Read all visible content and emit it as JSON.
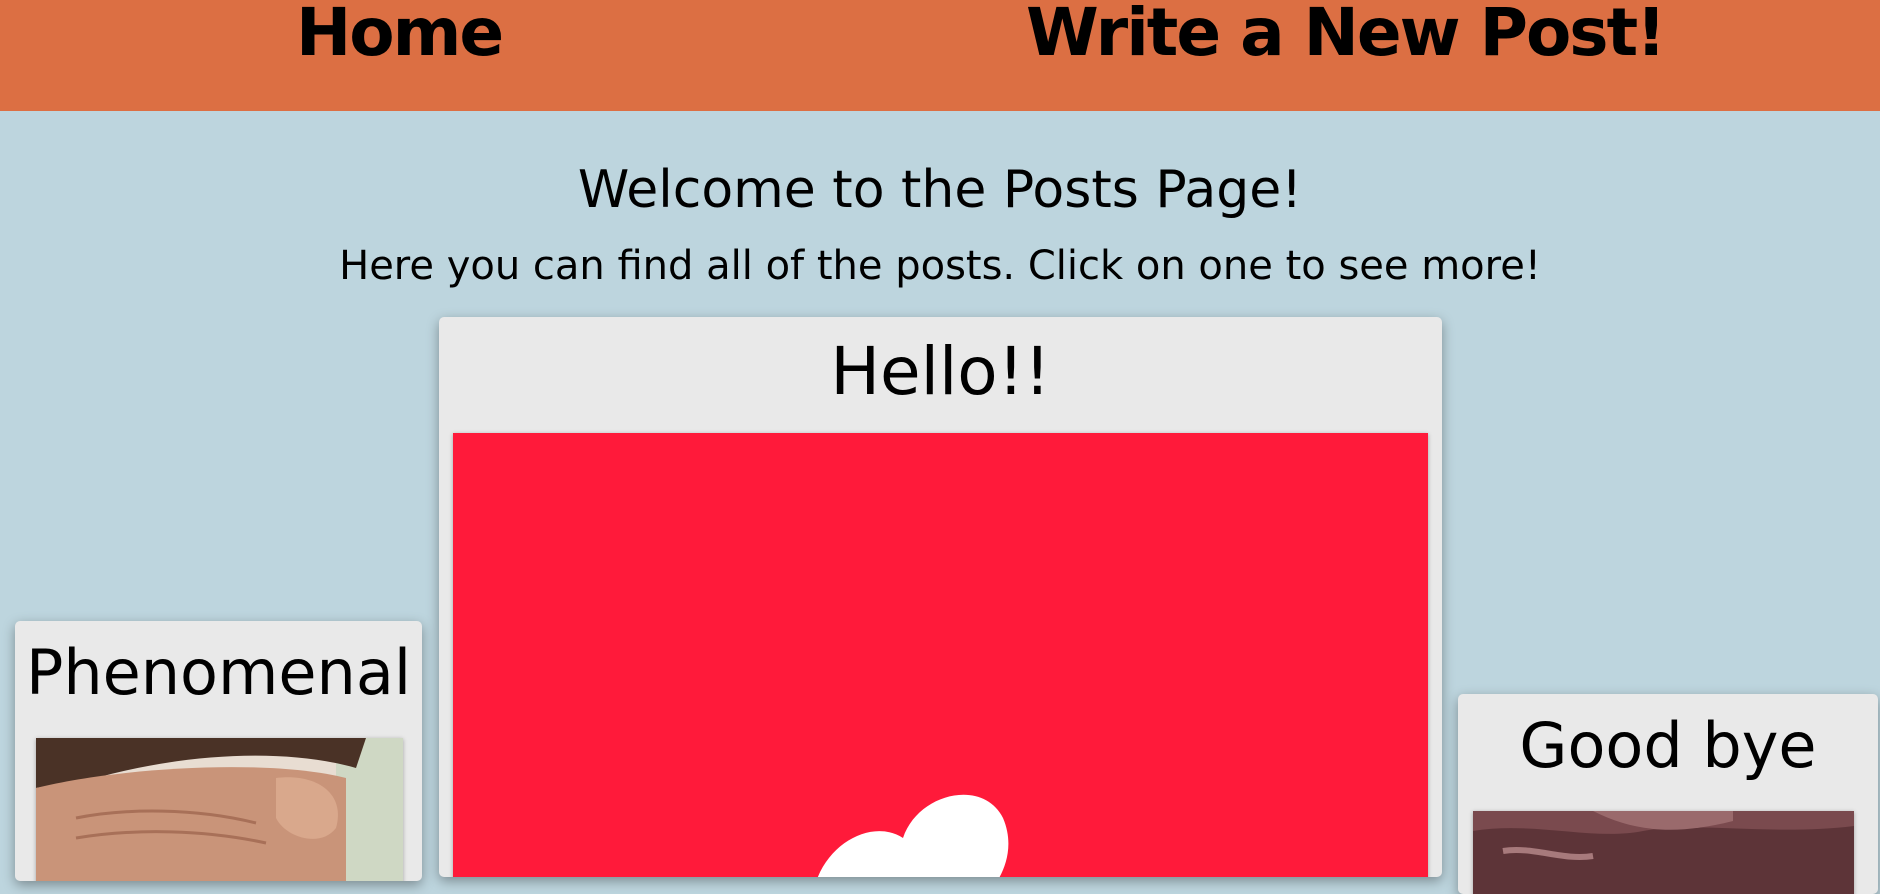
{
  "nav": {
    "home_label": "Home",
    "write_label": "Write a New Post!",
    "bar_color": "#dc6f43"
  },
  "page": {
    "title": "Welcome to the Posts Page!",
    "subtitle": "Here you can find all of the posts. Click on one to see more!",
    "background_color": "#bdd5de"
  },
  "posts": [
    {
      "title": "Phenomenal",
      "image": "man-rubbing-temples-photo"
    },
    {
      "title": "Hello!!",
      "image": "white-heart-on-red-background"
    },
    {
      "title": "Good bye",
      "image": "person-on-couch-photo"
    }
  ]
}
